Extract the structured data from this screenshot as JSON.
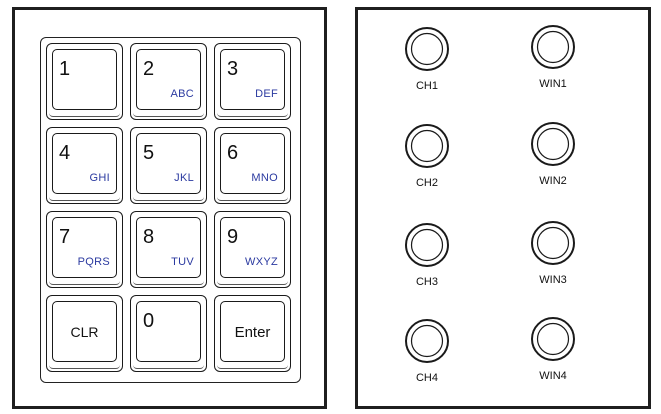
{
  "keypad": {
    "keys": [
      {
        "digit": "1",
        "letters": ""
      },
      {
        "digit": "2",
        "letters": "ABC"
      },
      {
        "digit": "3",
        "letters": "DEF"
      },
      {
        "digit": "4",
        "letters": "GHI"
      },
      {
        "digit": "5",
        "letters": "JKL"
      },
      {
        "digit": "6",
        "letters": "MNO"
      },
      {
        "digit": "7",
        "letters": "PQRS"
      },
      {
        "digit": "8",
        "letters": "TUV"
      },
      {
        "digit": "9",
        "letters": "WXYZ"
      },
      {
        "word": "CLR"
      },
      {
        "digit": "0",
        "letters": ""
      },
      {
        "word": "Enter"
      }
    ],
    "letter_color": "#2b3aa0"
  },
  "channels": {
    "ch": [
      {
        "label": "CH1"
      },
      {
        "label": "CH2"
      },
      {
        "label": "CH3"
      },
      {
        "label": "CH4"
      }
    ],
    "win": [
      {
        "label": "WIN1"
      },
      {
        "label": "WIN2"
      },
      {
        "label": "WIN3"
      },
      {
        "label": "WIN4"
      }
    ]
  }
}
